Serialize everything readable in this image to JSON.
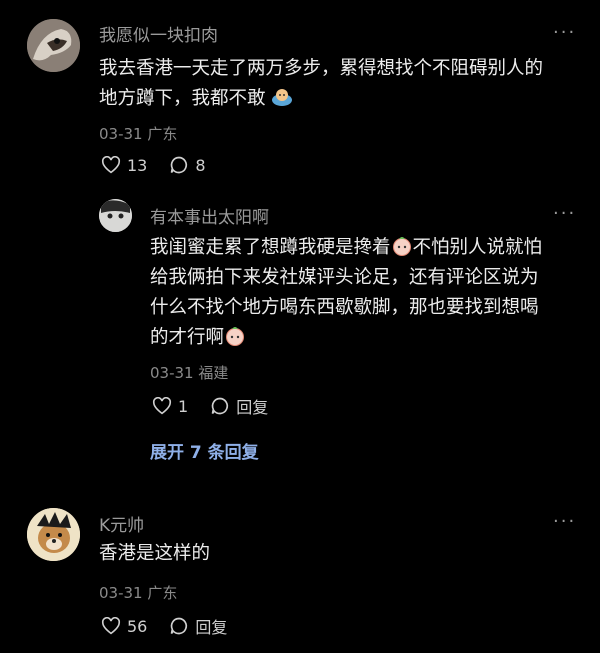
{
  "comments": [
    {
      "user": "我愿似一块扣肉",
      "text_line1": "我去香港一天走了两万多步，累得想找个不阻碍别人的",
      "text_line2": "地方蹲下，我都不敢",
      "meta": "03-31 广东",
      "likes": "13",
      "replies": "8",
      "more": "···"
    },
    {
      "user": "有本事出太阳啊",
      "text_line1a": "我闺蜜走累了想蹲我硬是搀着",
      "text_line1b": "不怕别人说就怕",
      "text_line2": "给我俩拍下来发社媒评头论足，还有评论区说为",
      "text_line3": "什么不找个地方喝东西歇歇脚，那也要找到想喝",
      "text_line4": "的才行啊",
      "meta": "03-31 福建",
      "likes": "1",
      "reply_label": "回复",
      "more": "···"
    },
    {
      "user": "K元帅",
      "text": "香港是这样的",
      "meta": "03-31 广东",
      "likes": "56",
      "reply_label": "回复",
      "more": "···"
    }
  ],
  "expand_label": "展开 7 条回复",
  "icons": [
    "heart-icon",
    "comment-bubble-icon",
    "more-icon",
    "emoji-icon"
  ],
  "colors": {
    "background": "#000000",
    "expand": "#8fb0e8",
    "meta": "#8a8a8a"
  }
}
